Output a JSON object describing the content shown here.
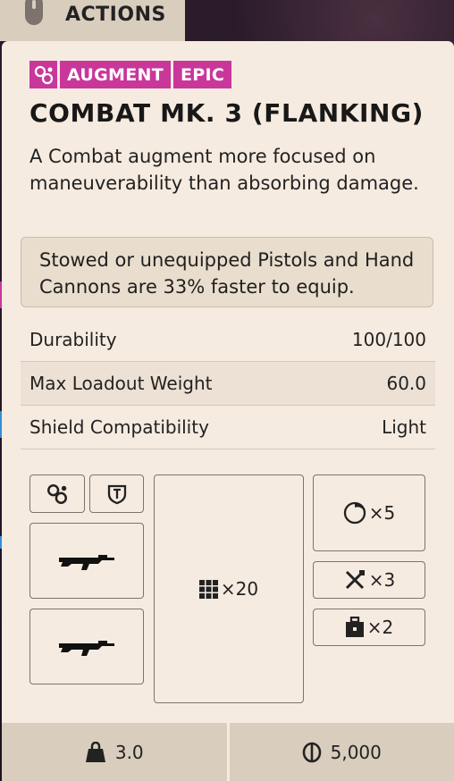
{
  "header": {
    "actions_label": "ACTIONS",
    "icon": "mouse-icon"
  },
  "item": {
    "tags": [
      "AUGMENT",
      "EPIC"
    ],
    "tag_icon": "augment-icon",
    "title": "COMBAT MK. 3 (FLANKING)",
    "description": "A Combat augment more focused on maneuverability than absorbing damage.",
    "perk": "Stowed or unequipped Pistols and Hand Cannons are 33% faster to equip.",
    "stats": [
      {
        "label": "Durability",
        "value": "100/100"
      },
      {
        "label": "Max Loadout Weight",
        "value": "60.0"
      },
      {
        "label": "Shield Compatibility",
        "value": "Light"
      }
    ],
    "slots": {
      "augment_slot_icon": "augment-icon",
      "shield_slot_icon": "shield-icon",
      "weapon_slots": [
        "rifle-icon",
        "rifle-icon"
      ],
      "backpack": {
        "icon": "grid-icon",
        "count": "×20"
      },
      "quick_use": {
        "icon": "grenade-icon",
        "count": "×5"
      },
      "tools": {
        "icon": "tools-icon",
        "count": "×3"
      },
      "safe_pocket": {
        "icon": "case-icon",
        "count": "×2"
      }
    },
    "footer": {
      "weight": "3.0",
      "price": "5,000",
      "weight_icon": "weight-icon",
      "currency_icon": "coin-icon"
    }
  },
  "colors": {
    "accent": "#c9379b",
    "card_bg": "#f6ebe0",
    "bar_bg": "#d9cdbd"
  }
}
